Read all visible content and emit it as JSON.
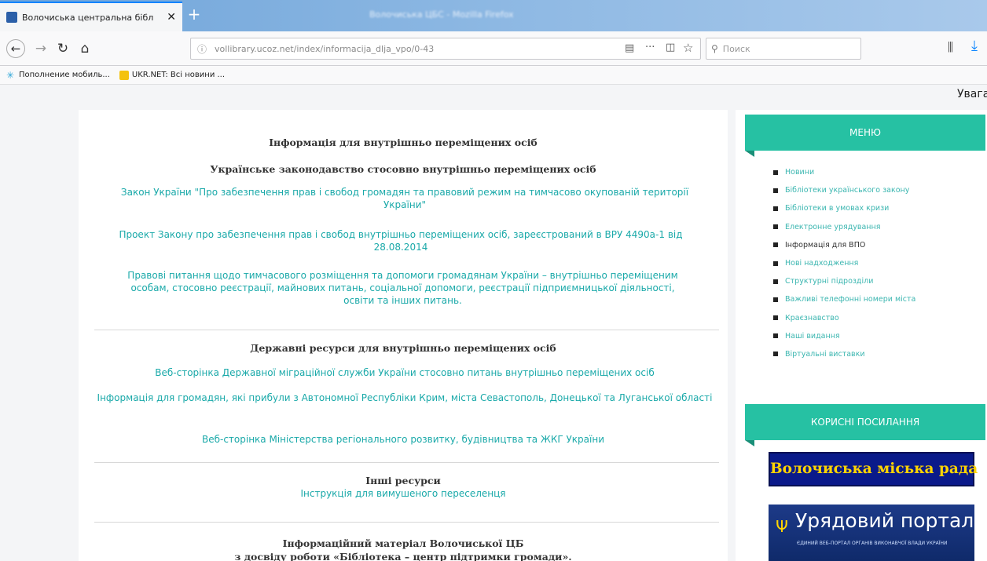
{
  "browser": {
    "tab_title": "Волочиська центральна бібл",
    "window_title": "Волочиська ЦБС - Mozilla Firefox",
    "url": "vollibrary.ucoz.net/index/informacija_dlja_vpo/0-43",
    "search_placeholder": "Поиск",
    "bookmarks": [
      "Пополнение мобиль...",
      "UKR.NET: Всі новини ..."
    ],
    "icons": [
      "back-icon",
      "forward-icon",
      "reload-icon",
      "home-icon",
      "info-icon",
      "reader-icon",
      "more-icon",
      "pocket-icon",
      "star-icon",
      "search-icon",
      "library-icon",
      "download-icon"
    ]
  },
  "page": {
    "notice": "Увага",
    "main": {
      "title": "Інформація для внутрішньо переміщених осіб",
      "law_heading": "Українське законодавство стосовно внутрішньо переміщених осіб",
      "law_links": [
        "Закон України \"Про забезпечення прав і свобод громадян та правовий режим на тимчасово окупованій території України\"",
        "Проект Закону про забезпечення прав і свобод внутрішньо переміщених осіб, зареєстрований в ВРУ 4490а-1 від 28.08.2014",
        "Правові питання щодо тимчасового розміщення та допомоги громадянам України – внутрішньо переміщеним особам, стосовно реєстрації, майнових питань, соціальної допомоги, реєстрації підприємницької діяльності, освіти та інших питань."
      ],
      "state_heading": "Державні ресурси для внутрішньо переміщених осіб",
      "state_links": [
        "Веб-сторінка Державної міграційної служби України стосовно питань внутрішньо переміщених осіб",
        "Інформація для громадян, які прибули з Автономної Республіки Крим, міста Севастополь, Донецької та Луганської області",
        "Веб-сторінка Міністерства регіонального розвитку, будівництва та ЖКГ України"
      ],
      "other_heading": "Інші ресурси",
      "other_link": "Інструкція для вимушеного переселенця",
      "info_heading_1": "Інформаційний матеріал Волочиської ЦБ",
      "info_heading_2": "з досвіду роботи  «Бібліотека – центр підтримки громади»."
    },
    "sidebar": {
      "menu_title": "МЕНЮ",
      "menu_items": [
        "Новини",
        "Бібліотеки українського закону",
        "Бібліотеки в умовах кризи",
        "Електронне урядування",
        "Інформація для ВПО",
        "Нові надходження",
        "Структурні підрозділи",
        "Важливі телефонні номери міста",
        "Краєзнавство",
        "Наші видання",
        "Віртуальні виставки"
      ],
      "active_index": 4,
      "links_title": "КОРИСНІ ПОСИЛАННЯ",
      "banner_council": "Волочиська міська рада",
      "banner_portal": "Урядовий портал",
      "banner_portal_sub": "ЄДИНИЙ ВЕБ-ПОРТАЛ ОРГАНІВ ВИКОНАВЧОЇ ВЛАДИ УКРАЇНИ"
    }
  },
  "colors": {
    "accent": "#26c1a3",
    "link": "#1aa9a9",
    "banner_bg": "#0a1a8a",
    "banner_text": "#ffd400"
  }
}
